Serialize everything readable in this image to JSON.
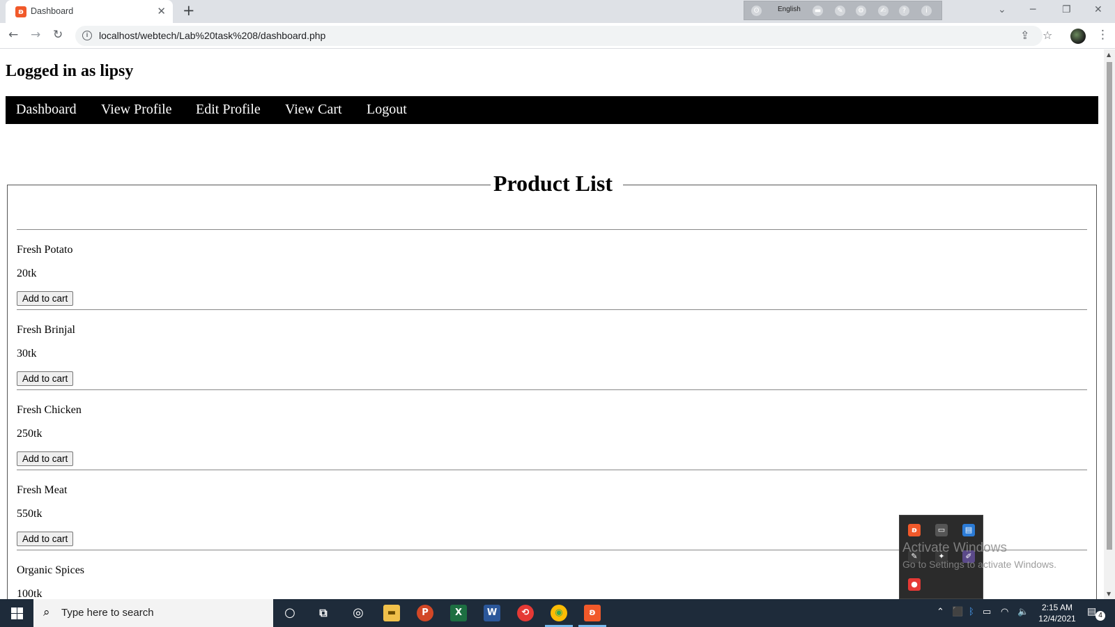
{
  "browser": {
    "tab_title": "Dashboard",
    "new_tab_symbol": "+",
    "url": "localhost/webtech/Lab%20task%208/dashboard.php",
    "ime_language": "English"
  },
  "page": {
    "login_heading": "Logged in as lipsy",
    "nav": [
      "Dashboard",
      "View Profile",
      "Edit Profile",
      "View Cart",
      "Logout"
    ],
    "product_list_title": "Product List",
    "add_button_label": "Add to cart",
    "products": [
      {
        "name": "Fresh Potato",
        "price": "20tk"
      },
      {
        "name": "Fresh Brinjal",
        "price": "30tk"
      },
      {
        "name": "Fresh Chicken",
        "price": "250tk"
      },
      {
        "name": "Fresh Meat",
        "price": "550tk"
      },
      {
        "name": "Organic Spices",
        "price": "100tk"
      }
    ]
  },
  "watermark": {
    "title": "Activate Windows",
    "subtitle": "Go to Settings to activate Windows."
  },
  "taskbar": {
    "search_placeholder": "Type here to search",
    "time": "2:15 AM",
    "date": "12/4/2021",
    "notification_count": "4"
  },
  "colors": {
    "nav_background": "#000000",
    "nav_text": "#ffffff",
    "taskbar": "#1e2b3a",
    "xampp_orange": "#f1592a"
  }
}
